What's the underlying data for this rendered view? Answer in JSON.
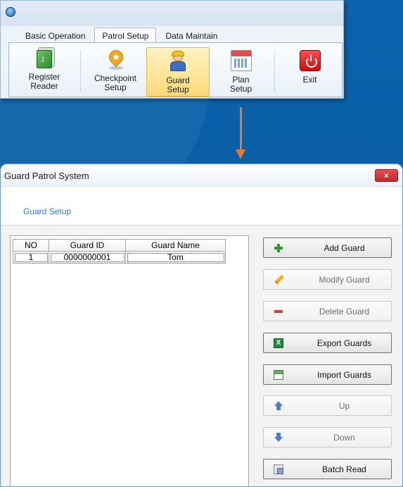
{
  "ribbon": {
    "tabs": [
      {
        "label": "Basic Operation",
        "active": false
      },
      {
        "label": "Patrol Setup",
        "active": true
      },
      {
        "label": "Data Maintain",
        "active": false
      }
    ],
    "buttons": [
      {
        "label": "Register\nReader",
        "icon": "reader-icon",
        "active": false
      },
      {
        "label": "Checkpoint\nSetup",
        "icon": "location-pin-icon",
        "active": false
      },
      {
        "label": "Guard\nSetup",
        "icon": "guard-icon",
        "active": true
      },
      {
        "label": "Plan\nSetup",
        "icon": "calendar-icon",
        "active": false
      },
      {
        "label": "Exit",
        "icon": "power-icon",
        "active": false
      }
    ]
  },
  "dialog": {
    "title": "Guard Patrol System",
    "close_label": "×",
    "heading": "Guard Setup",
    "table": {
      "columns": [
        "NO",
        "Guard ID",
        "Guard Name"
      ],
      "rows": [
        [
          "1",
          "0000000001",
          "Tom"
        ]
      ]
    },
    "actions": [
      {
        "label": "Add Guard",
        "icon": "plus-icon",
        "enabled": true
      },
      {
        "label": "Modify Guard",
        "icon": "pencil-icon",
        "enabled": false
      },
      {
        "label": "Delete Guard",
        "icon": "minus-icon",
        "enabled": false
      },
      {
        "label": "Export Guards",
        "icon": "excel-icon",
        "enabled": true
      },
      {
        "label": "Import Guards",
        "icon": "import-icon",
        "enabled": true
      },
      {
        "label": "Up",
        "icon": "arrow-up-icon",
        "enabled": false
      },
      {
        "label": "Down",
        "icon": "arrow-down-icon",
        "enabled": false
      },
      {
        "label": "Batch Read",
        "icon": "batch-read-icon",
        "enabled": true
      }
    ]
  },
  "colors": {
    "background": "#0a5fa8",
    "arrow": "#e8782c",
    "heading": "#2a7fd4",
    "close": "#d63a3a"
  }
}
